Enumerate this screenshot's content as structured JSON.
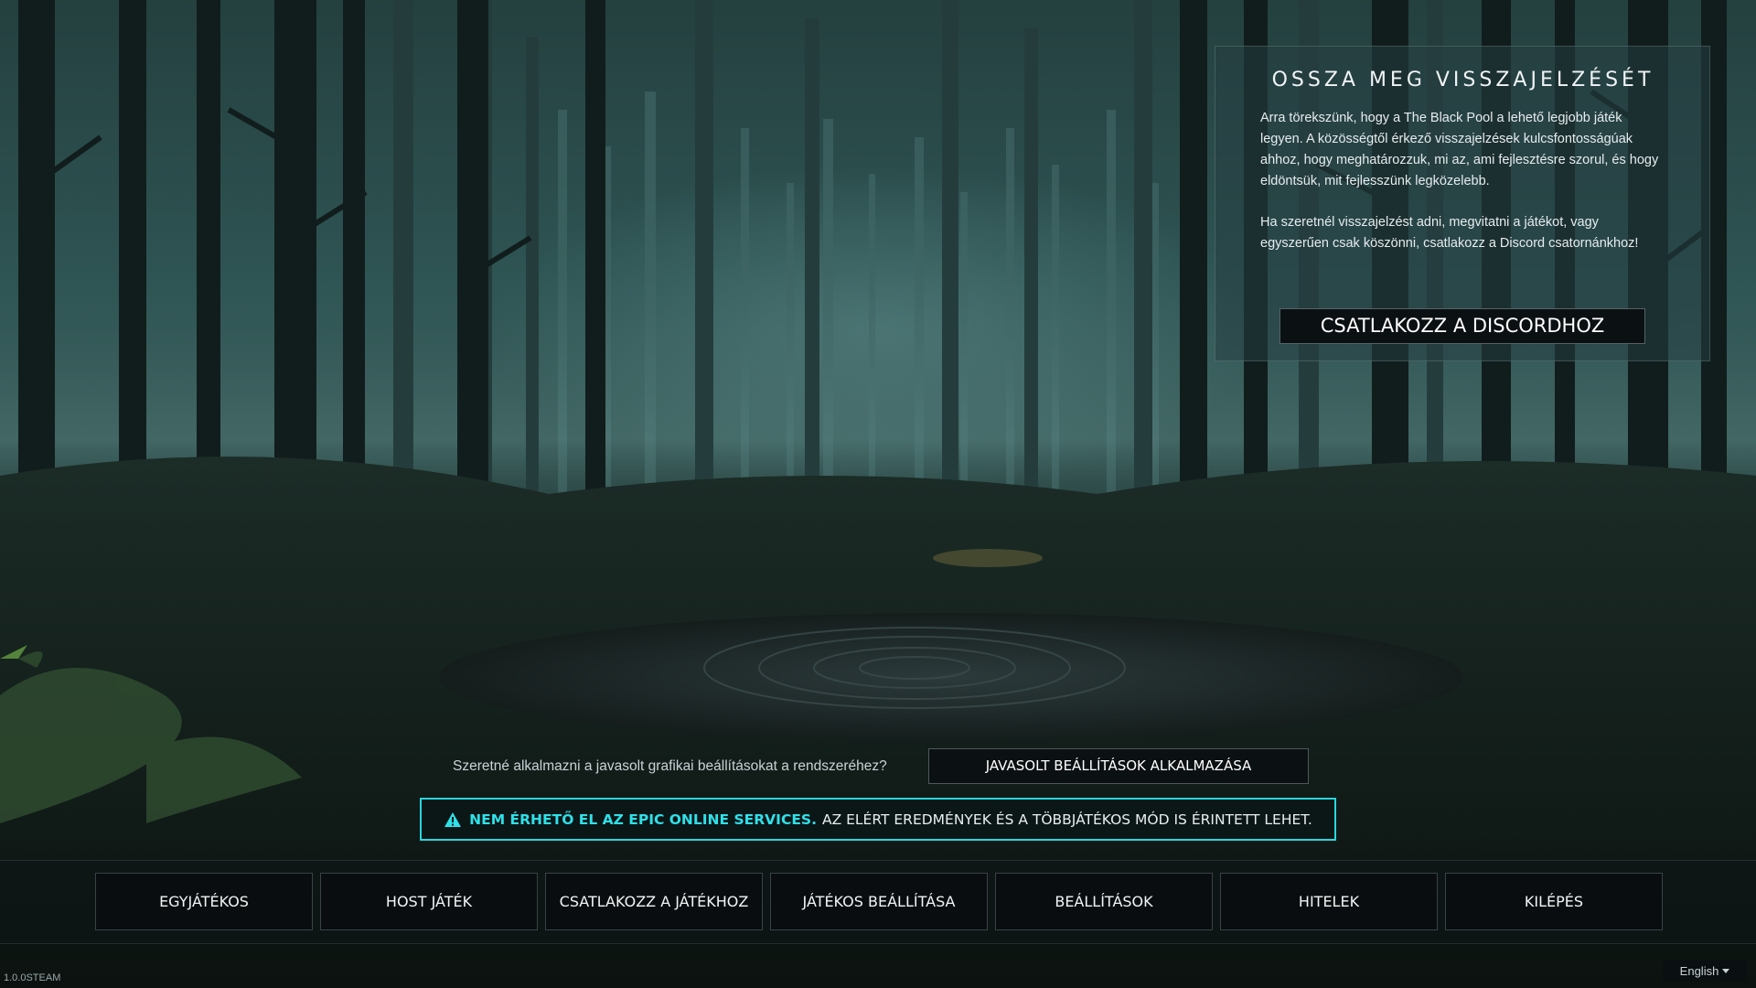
{
  "feedback": {
    "title": "OSSZA MEG VISSZAJELZÉSÉT",
    "paragraph1": "Arra törekszünk, hogy a The Black Pool a lehető legjobb játék legyen. A közösségtől érkező visszajelzések kulcsfontosságúak ahhoz, hogy meghatározzuk, mi az, ami fejlesztésre szorul, és hogy eldöntsük, mit fejlesszünk legközelebb.",
    "paragraph2": "Ha szeretnél visszajelzést adni, megvitatni a játékot, vagy egyszerűen csak köszönni, csatlakozz a Discord csatornánkhoz!",
    "discord_button": "CSATLAKOZZ A DISCORDHOZ"
  },
  "recommend": {
    "question": "Szeretné alkalmazni a javasolt grafikai beállításokat a rendszeréhez?",
    "button": "JAVASOLT BEÁLLÍTÁSOK ALKALMAZÁSA"
  },
  "eos_banner": {
    "icon": "warning-icon",
    "strong": "NEM ÉRHETŐ EL AZ EPIC ONLINE SERVICES.",
    "rest": "AZ ELÉRT EREDMÉNYEK ÉS A TÖBBJÁTÉKOS MÓD IS ÉRINTETT LEHET.",
    "accent_color": "#2fe0e8"
  },
  "menu": {
    "items": [
      {
        "label": "EGYJÁTÉKOS"
      },
      {
        "label": "HOST JÁTÉK"
      },
      {
        "label": "CSATLAKOZZ A JÁTÉKHOZ"
      },
      {
        "label": "JÁTÉKOS BEÁLLÍTÁSA"
      },
      {
        "label": "BEÁLLÍTÁSOK"
      },
      {
        "label": "HITELEK"
      },
      {
        "label": "KILÉPÉS"
      }
    ]
  },
  "footer": {
    "version": "1.0.0STEAM",
    "language": "English"
  }
}
